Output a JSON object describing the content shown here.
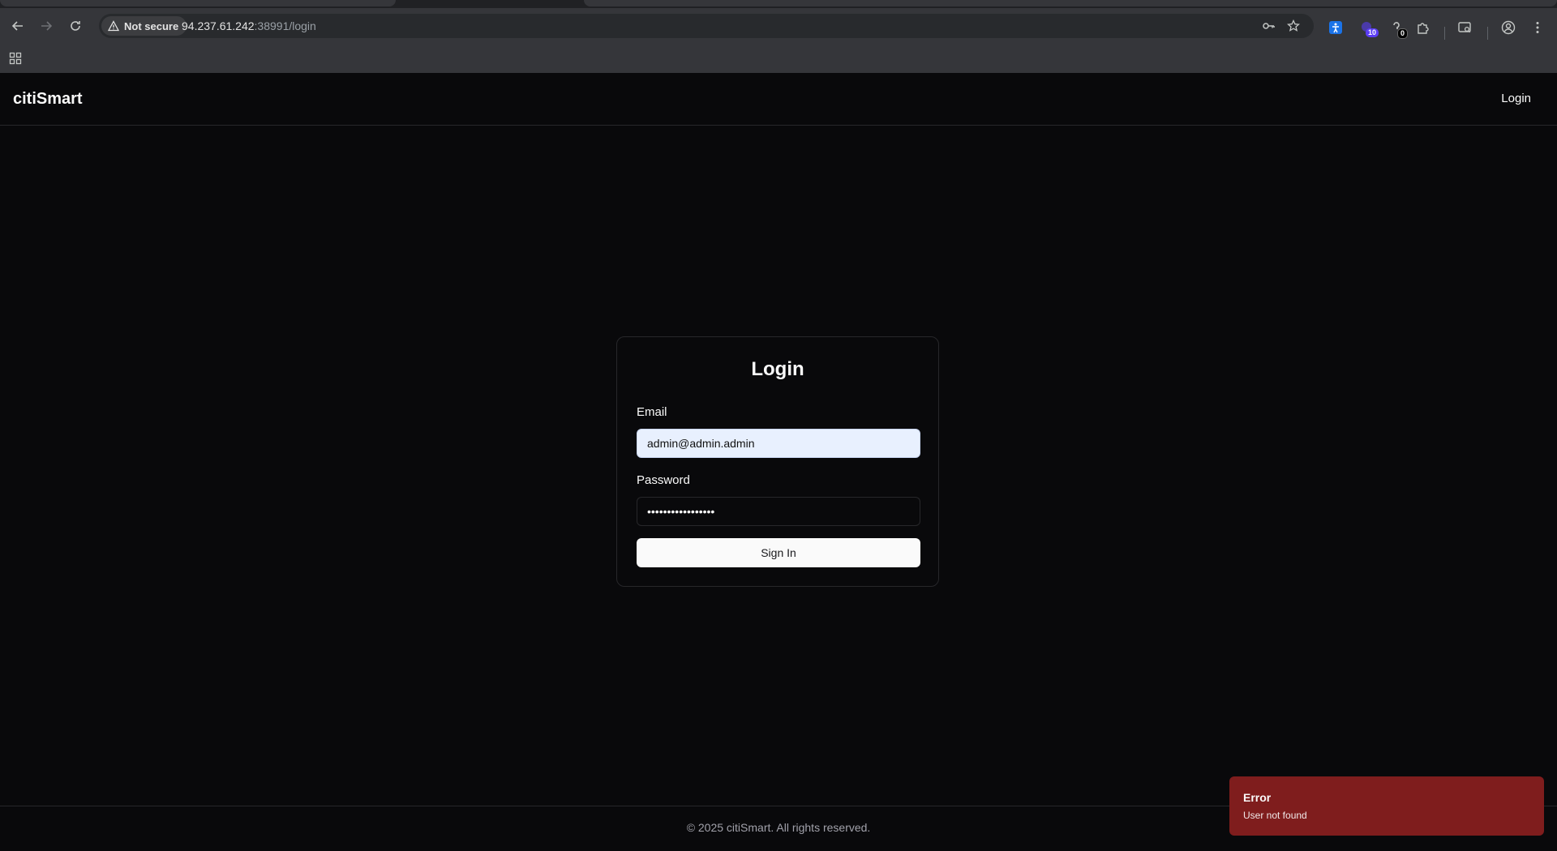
{
  "browser": {
    "security_label": "Not secure",
    "url_host": "94.237.61.242",
    "url_rest": ":38991/login",
    "extensions": [
      {
        "icon": "accessibility-extension-icon"
      },
      {
        "icon": "puzzle-badge-extension-icon",
        "badge": "10",
        "badge_color": "#5b3df5"
      },
      {
        "icon": "counter-extension-icon",
        "badge": "0",
        "badge_color": "#000000"
      }
    ]
  },
  "header": {
    "brand": "citiSmart",
    "nav_login": "Login"
  },
  "login": {
    "title": "Login",
    "email_label": "Email",
    "email_value": "admin@admin.admin",
    "password_label": "Password",
    "password_value": "•••••••••••••••••",
    "submit_label": "Sign In"
  },
  "footer": {
    "text": "© 2025 citiSmart. All rights reserved."
  },
  "toast": {
    "title": "Error",
    "description": "User not found",
    "color": "#7f1d1d"
  },
  "colors": {
    "background": "#09090b",
    "border": "#27272a",
    "autofill": "#e8f0fe"
  }
}
